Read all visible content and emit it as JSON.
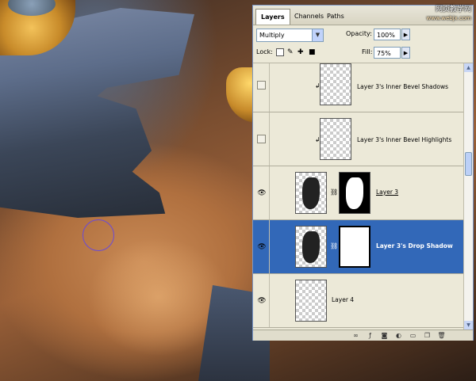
{
  "panel": {
    "tabs": [
      "Layers",
      "Channels",
      "Paths"
    ],
    "watermark": {
      "line1": "网页教学网",
      "line2": "www.webjx.com"
    },
    "blend_mode": "Multiply",
    "opacity_label": "Opacity:",
    "opacity_value": "100%",
    "lock_label": "Lock:",
    "fill_label": "Fill:",
    "fill_value": "75%",
    "layers": [
      {
        "name": "Layer 3's Inner Bevel Shadows",
        "visible": false,
        "selected": false
      },
      {
        "name": "Layer 3's Inner Bevel Highlights",
        "visible": false,
        "selected": false
      },
      {
        "name": "Layer 3",
        "visible": true,
        "selected": false
      },
      {
        "name": "Layer 3's Drop Shadow",
        "visible": true,
        "selected": true
      },
      {
        "name": "Layer 4",
        "visible": true,
        "selected": false
      }
    ]
  },
  "colors": {
    "selection": "#3268b8",
    "panel_bg": "#ece9d8"
  }
}
